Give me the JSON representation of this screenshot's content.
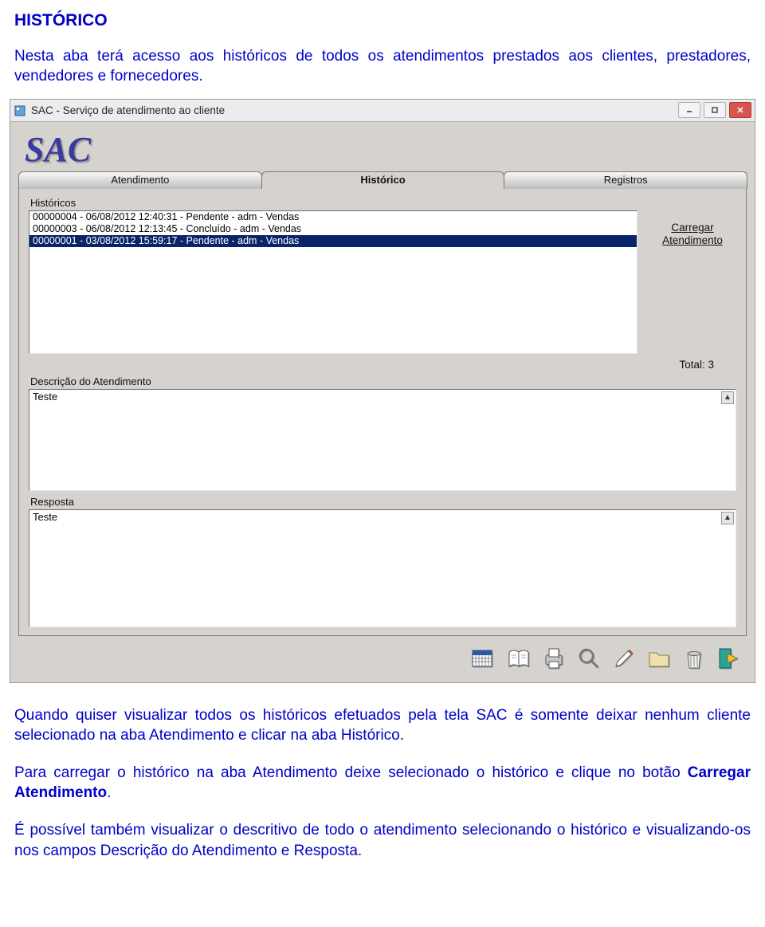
{
  "heading": "HISTÓRICO",
  "intro": "Nesta aba terá acesso aos históricos de todos os atendimentos prestados aos clientes, prestadores, vendedores e fornecedores.",
  "para1": "Quando quiser visualizar todos os históricos efetuados pela tela SAC é somente deixar nenhum cliente selecionado na aba Atendimento e clicar na aba Histórico.",
  "para2_a": "Para carregar o histórico na aba Atendimento deixe selecionado o histórico e clique no botão ",
  "para2_bold": "Carregar Atendimento",
  "para2_b": ".",
  "para3": "É possível também visualizar o descritivo de todo o atendimento selecionando o histórico e visualizando-os nos campos Descrição do Atendimento e Resposta.",
  "window": {
    "title": "SAC - Serviço de atendimento ao cliente",
    "logo": "SAC",
    "tabs": {
      "t1": "Atendimento",
      "t2": "Histórico",
      "t3": "Registros"
    },
    "labels": {
      "historicos": "Históricos",
      "descricao": "Descrição do Atendimento",
      "resposta": "Resposta"
    },
    "list": {
      "l0": "00000004 - 06/08/2012 12:40:31 - Pendente - adm - Vendas",
      "l1": "00000003 - 06/08/2012 12:13:45 - Concluído - adm - Vendas",
      "l2": "00000001 - 03/08/2012 15:59:17 - Pendente - adm - Vendas"
    },
    "descricao_text": "Teste",
    "resposta_text": "Teste",
    "carregar_line1": "Carregar",
    "carregar_line2": "Atendimento",
    "total_label": "Total: 3"
  }
}
